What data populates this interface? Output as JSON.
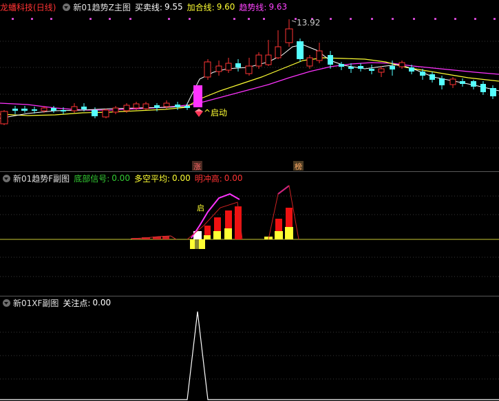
{
  "main_pane": {
    "stock_name": "龙蟠科技",
    "period": "(日线)",
    "indicator_name": "新01趋势Z主图",
    "buy_line_label": "买卖线:",
    "buy_line_value": "9.55",
    "add_line_label": "加合线:",
    "add_line_value": "9.60",
    "trend_line_label": "趋势线:",
    "trend_line_value": "9.63",
    "high_price_label": "13.92",
    "start_signal_label": "^启动",
    "marker_zhang": "涨",
    "marker_bang": "榜",
    "colors": {
      "buy": "#ffffff",
      "add": "#ffff33",
      "trend": "#ff33ff"
    }
  },
  "sub_pane_1": {
    "indicator_name": "新01趋势F副图",
    "bottom_signal_label": "底部信号:",
    "bottom_signal_value": "0.00",
    "long_short_label": "多空平均:",
    "long_short_value": "0.00",
    "bright_high_label": "明冲高:",
    "bright_high_value": "0.00",
    "start_label": "启",
    "colors": {
      "bottom": "#33cc33",
      "long_short": "#ffff33",
      "bright": "#ff3333"
    }
  },
  "sub_pane_2": {
    "indicator_name": "新01XF副图",
    "focus_label": "关注点:",
    "focus_value": "0.00"
  },
  "chart_data": {
    "type": "candlestick",
    "title": "龙蟠科技 (日线)",
    "max_label": 13.92,
    "series": [
      {
        "name": "买卖线",
        "last": 9.55
      },
      {
        "name": "加合线",
        "last": 9.6
      },
      {
        "name": "趋势线",
        "last": 9.63
      }
    ]
  }
}
